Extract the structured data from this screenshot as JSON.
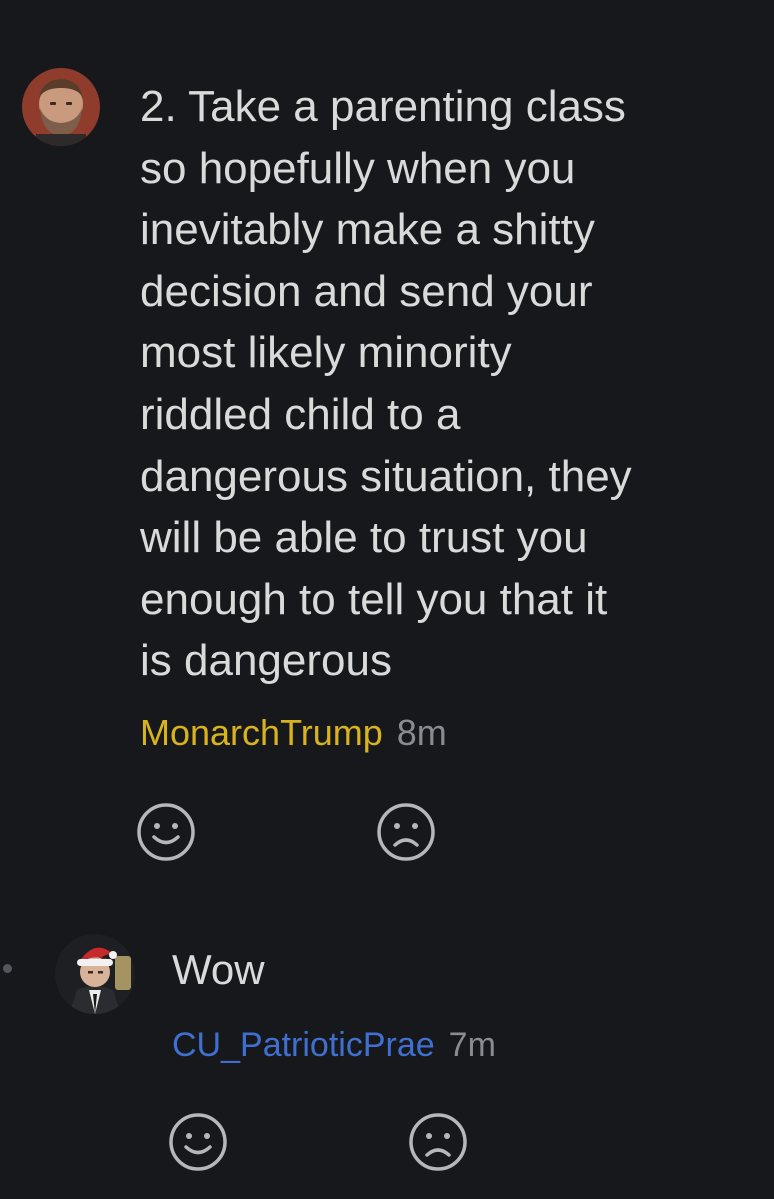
{
  "comments": [
    {
      "text": "2. Take a parenting class\nso hopefully when you\ninevitably make a shitty\ndecision and send your\nmost likely minority\nriddled child to a\ndangerous situation, they\nwill be able to trust you\nenough to tell you that it\nis dangerous",
      "username": "MonarchTrump",
      "time": "8m",
      "avatar_icon": "bearded-man-avatar",
      "username_color": "#d8b31d"
    },
    {
      "text": "Wow",
      "username": "CU_PatrioticPrae",
      "time": "7m",
      "avatar_icon": "santa-hat-man-avatar",
      "username_color": "#3f6fd0"
    }
  ],
  "reactions": {
    "up_icon": "smiley-face-icon",
    "down_icon": "frown-face-icon"
  },
  "colors": {
    "background": "#17181c",
    "text": "#dadada",
    "meta": "#8a8b90"
  }
}
